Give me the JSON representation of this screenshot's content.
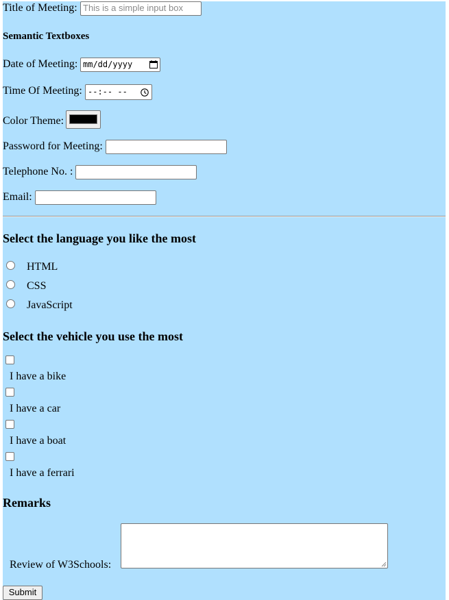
{
  "form": {
    "title_label": "Title of Meeting:",
    "title_placeholder": "This is a simple input box",
    "semantic_heading": "Semantic Textboxes",
    "date_label": "Date of Meeting:",
    "date_placeholder": "mm/dd/yyyy",
    "time_label": "Time Of Meeting:",
    "time_placeholder": "--:-- --",
    "color_label": "Color Theme:",
    "color_value": "#000000",
    "password_label": "Password for Meeting:",
    "telephone_label": "Telephone No. :",
    "email_label": "Email:"
  },
  "language": {
    "heading": "Select the language you like the most",
    "options": [
      "HTML",
      "CSS",
      "JavaScript"
    ]
  },
  "vehicle": {
    "heading": "Select the vehicle you use the most",
    "options": [
      "I have a bike",
      "I have a car",
      "I have a boat",
      "I have a ferrari"
    ]
  },
  "remarks": {
    "heading": "Remarks",
    "review_label": "Review of W3Schools:",
    "submit_label": "Submit"
  },
  "colors": {
    "page_background": "#b0e0fe"
  },
  "icons": {
    "date": "calendar-icon",
    "time": "clock-icon"
  }
}
